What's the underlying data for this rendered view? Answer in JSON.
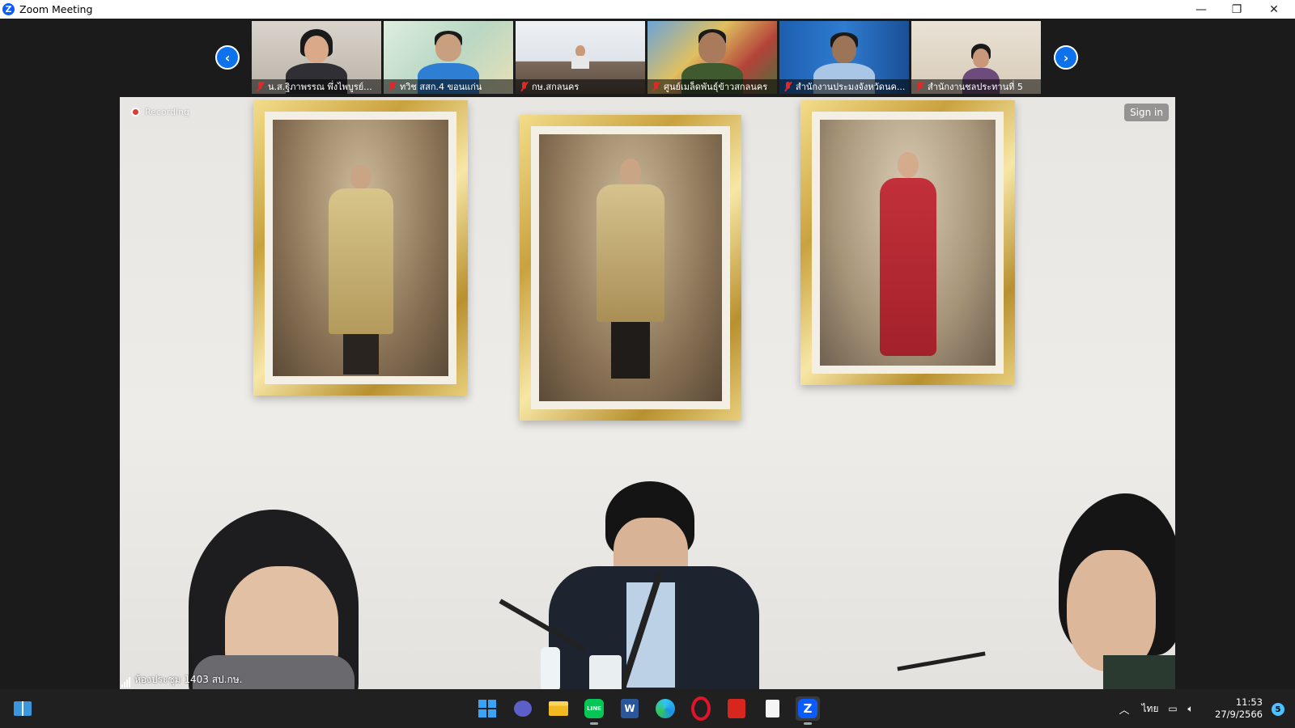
{
  "window": {
    "title": "Zoom Meeting",
    "app_icon": "Z",
    "controls": {
      "minimize": "—",
      "restore": "❐",
      "close": "✕"
    }
  },
  "gallery": {
    "prev_icon": "‹",
    "next_icon": "›",
    "participants": [
      {
        "name": "น.ส.ฐิภาพรรณ พึ่งไพบูรย์...",
        "muted": true
      },
      {
        "name": "ทวิช สสก.4 ขอนแก่น",
        "muted": true
      },
      {
        "name": "กษ.สกลนคร",
        "muted": true
      },
      {
        "name": "ศูนย์เมล็ดพันธุ์ข้าวสกลนคร",
        "muted": true
      },
      {
        "name": "สำนักงานประมงจังหวัดนค...",
        "muted": true
      },
      {
        "name": "สำนักงานชลประทานที่ 5",
        "muted": true
      }
    ]
  },
  "main_video": {
    "recording_label": "Recording",
    "sign_in_label": "Sign in",
    "room_name": "ห้องประชุม 1403 สป.กษ."
  },
  "taskbar": {
    "apps": [
      "start",
      "meet",
      "file-explorer",
      "line",
      "word",
      "edge",
      "opera",
      "acrobat",
      "notepad",
      "zoom"
    ],
    "line_label": "LINE",
    "word_label": "W",
    "zoom_label": "Z",
    "tray_language": "ไทย",
    "time": "11:53",
    "date": "27/9/2566",
    "notification_count": "5",
    "colors": {
      "accent": "#0e72ed",
      "zoom_blue": "#0b5cff",
      "line_green": "#06c755"
    }
  }
}
